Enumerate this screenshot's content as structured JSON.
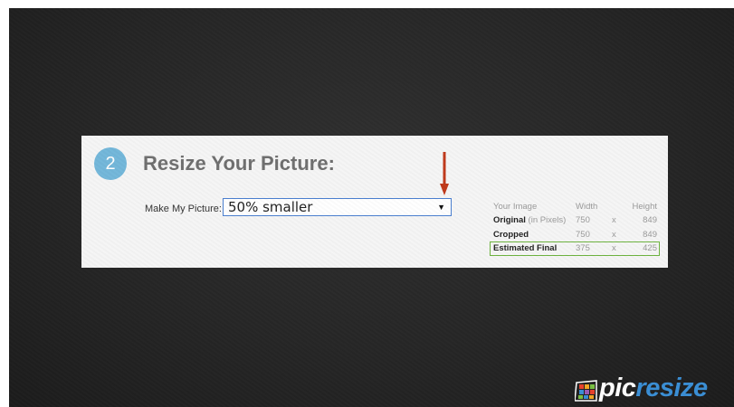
{
  "step": {
    "number": "2",
    "title": "Resize Your Picture:"
  },
  "resize": {
    "label": "Make My Picture:",
    "selected": "50% smaller"
  },
  "stats": {
    "header": {
      "label": "Your Image",
      "width": "Width",
      "height": "Height"
    },
    "original": {
      "label_bold": "Original",
      "label_note": " (in Pixels)",
      "width": "750",
      "x": "x",
      "height": "849"
    },
    "cropped": {
      "label": "Cropped",
      "width": "750",
      "x": "x",
      "height": "849"
    },
    "final": {
      "label": "Estimated Final",
      "width": "375",
      "x": "x",
      "height": "425"
    }
  },
  "logo": {
    "pic": "pic",
    "resize": "resize"
  },
  "colors": {
    "accent_circle": "#73b7da",
    "arrow": "#c0391b",
    "final_border": "#6db33f",
    "logo_blue": "#3a8fd6"
  }
}
